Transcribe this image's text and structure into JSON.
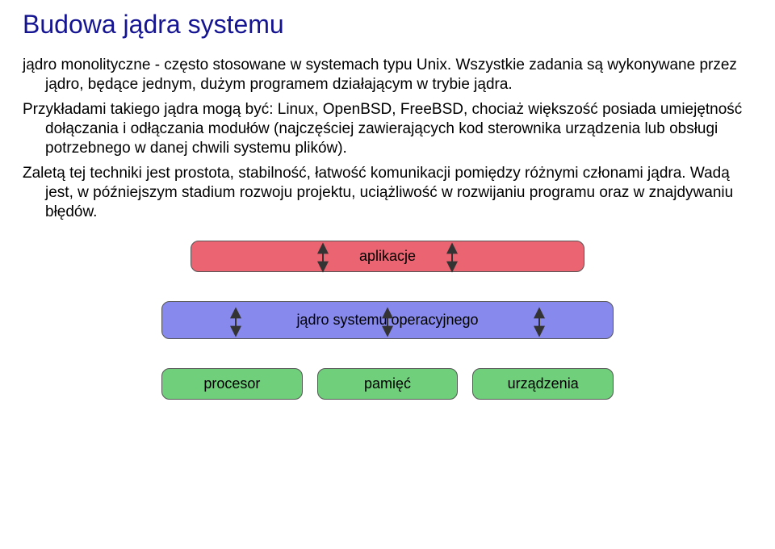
{
  "heading": "Budowa jądra systemu",
  "paragraphs": {
    "p1": "jądro monolityczne - często stosowane w systemach typu Unix. Wszystkie zadania są wykonywane przez jądro, będące jednym, dużym programem działającym w trybie jądra.",
    "p2": "Przykładami takiego jądra mogą być: Linux, OpenBSD, FreeBSD, chociaż większość posiada umiejętność dołączania i odłączania modułów (najczęściej zawierających kod sterownika urządzenia lub obsługi potrzebnego w danej chwili systemu plików).",
    "p3": "Zaletą tej techniki jest prostota, stabilność, łatwość komunikacji pomiędzy różnymi członami jądra. Wadą jest, w późniejszym stadium rozwoju projektu, uciążliwość w rozwijaniu programu oraz w znajdywaniu błędów."
  },
  "diagram": {
    "applications": "aplikacje",
    "kernel": "jądro systemu operacyjnego",
    "hw": {
      "cpu": "procesor",
      "memory": "pamięć",
      "devices": "urządzenia"
    }
  }
}
